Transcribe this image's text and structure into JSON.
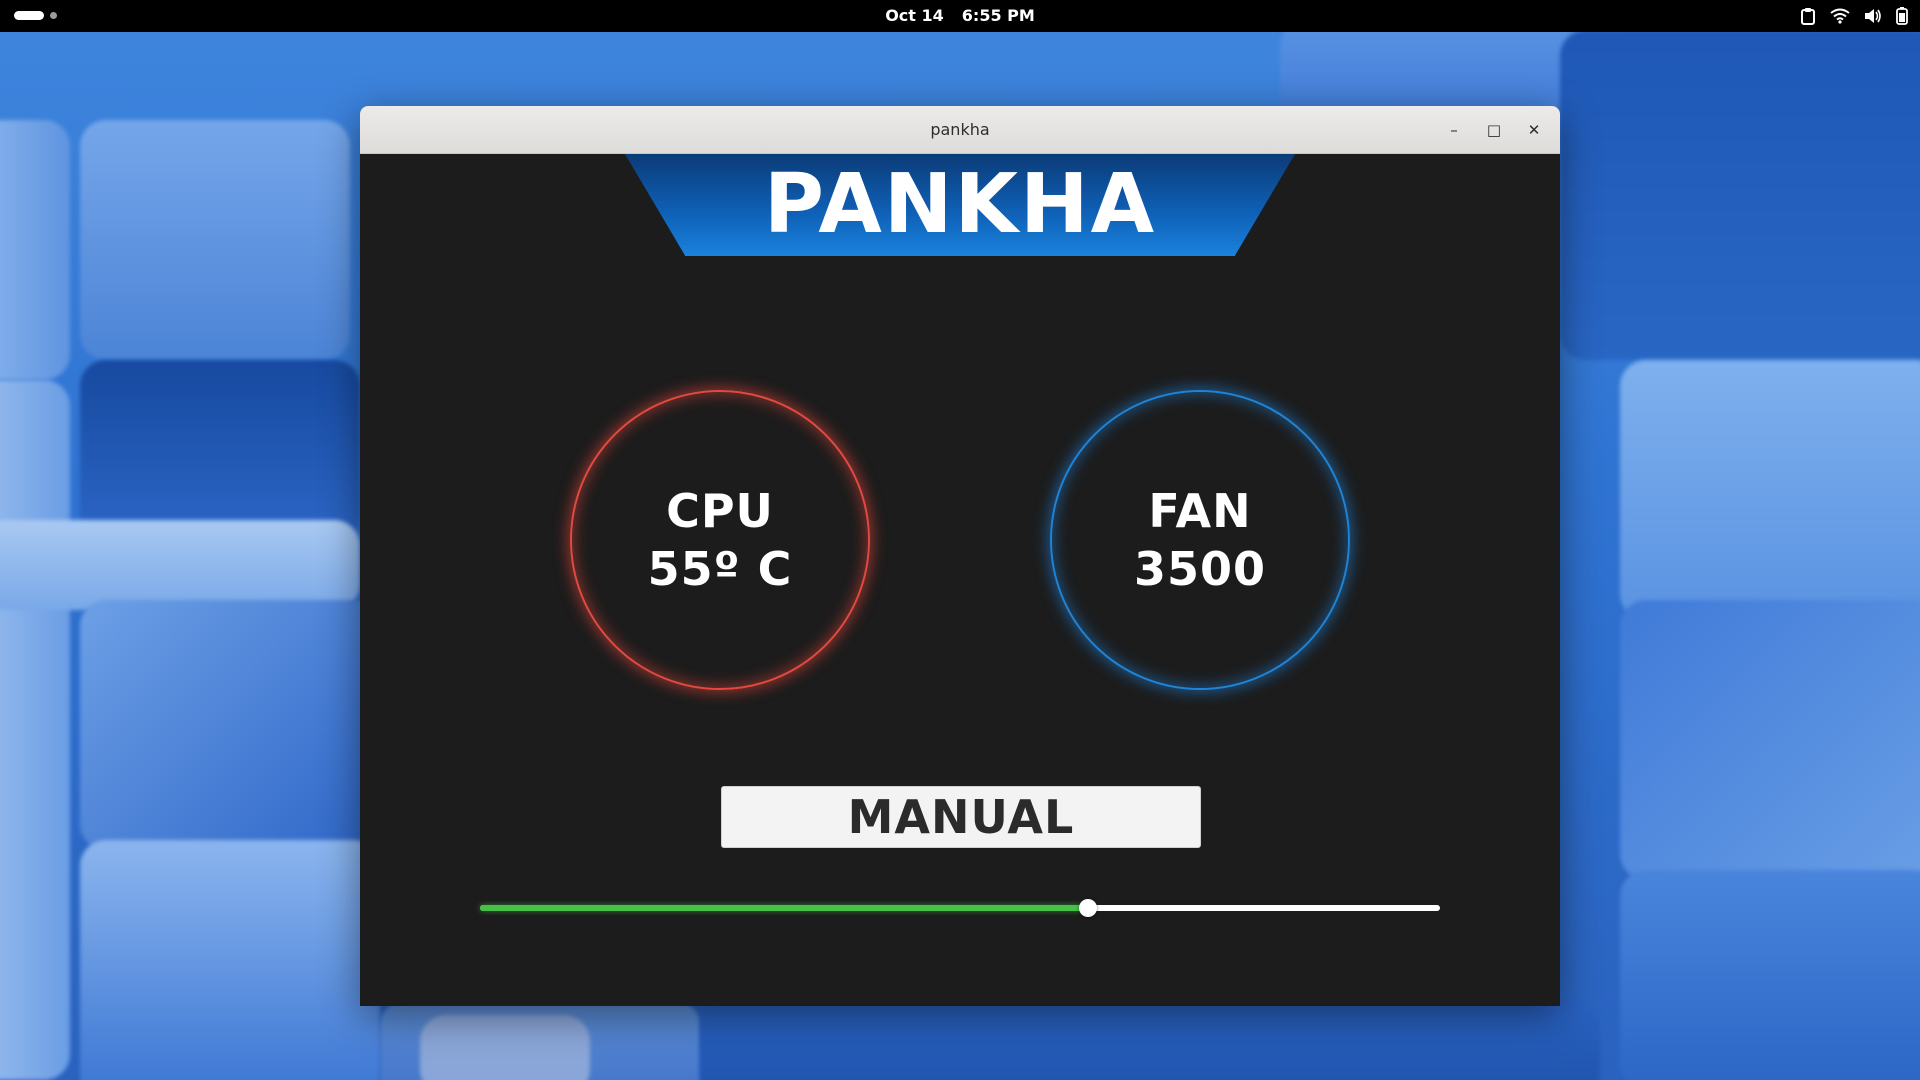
{
  "topbar": {
    "date": "Oct 14",
    "time": "6:55 PM",
    "icons": [
      "clipboard-icon",
      "wifi-icon",
      "volume-icon",
      "battery-icon"
    ]
  },
  "window": {
    "title": "pankha",
    "controls": {
      "minimize": "–",
      "maximize": "□",
      "close": "✕"
    }
  },
  "app": {
    "logo": "PANKHA",
    "cpu": {
      "label": "CPU",
      "value": "55º C",
      "color": "#e24a3f"
    },
    "fan": {
      "label": "FAN",
      "value": "3500",
      "color": "#1f83d6"
    },
    "mode_button": "MANUAL",
    "slider": {
      "value_fraction": 0.633,
      "fill_color": "#46c046"
    }
  }
}
